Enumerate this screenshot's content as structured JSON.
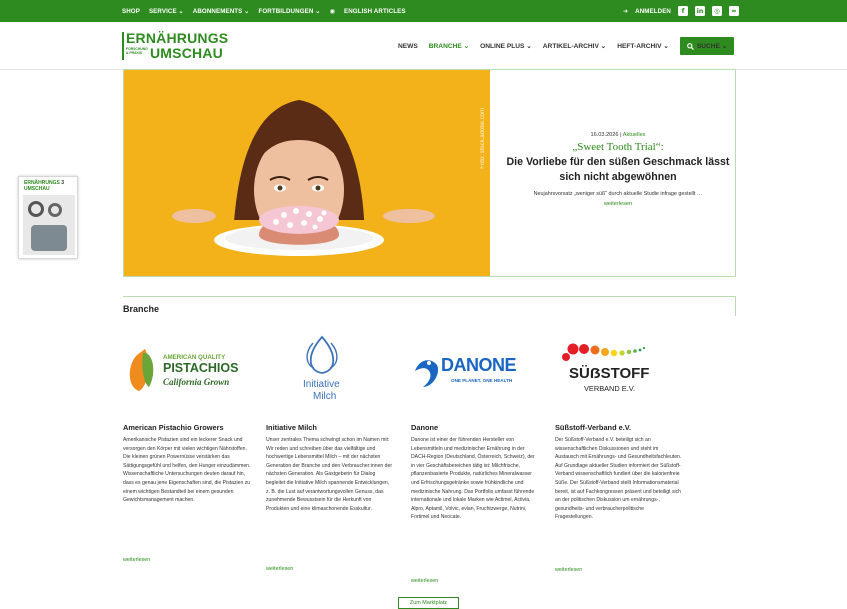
{
  "topbar": {
    "nav": [
      "SHOP",
      "SERVICE ⌄",
      "ABONNEMENTS ⌄",
      "FORTBILDUNGEN ⌄",
      "ENGLISH ARTICLES"
    ],
    "login": "ANMELDEN"
  },
  "header": {
    "logo_line1": "ERNÄHRUNGS",
    "logo_line2": "UMSCHAU",
    "logo_small": "FORSCHUNG & PRAXIS",
    "nav": [
      "NEWS",
      "BRANCHE ⌄",
      "ONLINE PLUS ⌄",
      "ARTIKEL-ARCHIV ⌄",
      "HEFT-ARCHIV ⌄"
    ],
    "search_label": "SUCHE ⌄"
  },
  "magazine": {
    "title_line1": "ERNÄHRUNGS",
    "title_line2": "UMSCHAU",
    "issue": "3"
  },
  "hero": {
    "date": "16.03.2026",
    "category": "Aktuelles",
    "title_quote": "„Sweet Tooth Trial“:",
    "title_main": "Die Vorliebe für den süßen Geschmack lässt sich nicht abgewöhnen",
    "excerpt": "Neujahrsvorsatz „weniger süß“ durch aktuelle Studie infrage gestellt …",
    "more": "weiterlesen",
    "image_credit": "Foto: stock.adobe.com"
  },
  "section": {
    "title": "Branche"
  },
  "cards": [
    {
      "name": "American Pistachio Growers",
      "logo": {
        "line1": "AMERICAN QUALITY",
        "line2": "PISTACHIOS",
        "line3": "California Grown"
      },
      "desc": "Amerikanische Pistazien sind ein leckerer Snack und versorgen den Körper mit vielen wichtigen Nährstoffen. Die kleinen grünen Powernüsse verstärken das Sättigungsgefühl und helfen, den Hunger einzudämmen. Wissenschaftliche Untersuchungen deuten darauf hin, dass es genau jene Eigenschaften sind, die Pistazien zu einem wichtigen Bestandteil bei einem gesunden Gewichtsmanagement machen.",
      "more": "weiterlesen"
    },
    {
      "name": "Initiative Milch",
      "logo": {
        "line1": "Initiative",
        "line2": "Milch"
      },
      "desc": "Unser zentrales Thema schwingt schon im Namen mit: Wir reden und schreiben über das vielfältige und hochwertige Lebensmittel Milch – mit der nächsten Generation der Branche und den Verbraucher:innen der nächsten Generation. Als Gastgeberin für Dialog begleitet die Initiative Milch spannende Entwicklungen, z. B. die Lust auf verantwortungsvollen Genuss, das zunehmende Bewusstsein für die Herkunft von Produkten und eine klimaschonende Esskultur.",
      "more": "weiterlesen"
    },
    {
      "name": "Danone",
      "logo": {
        "line1": "DANONE",
        "line2": "ONE PLANET. ONE HEALTH"
      },
      "desc": "Danone ist einer der führenden Hersteller von Lebensmitteln und medizinischer Ernährung in der DACH-Region (Deutschland, Österreich, Schweiz), der in vier Geschäftsbereichen tätig ist: Milchfrische, pflanzenbasierte Produkte, natürliches Mineralwasser und Erfrischungsgetränke sowie frühkindliche und medizinische Nahrung. Das Portfolio umfasst führende internationale und lokale Marken wie Actimel, Activia, Alpro, Aptamil, Volvic, evian, Fruchtzwerge, Nutrini, Fortimel und Neocate.",
      "more": "weiterlesen"
    },
    {
      "name": "Süßstoff-Verband e.V.",
      "logo": {
        "line1": "SÜẞSTOFF",
        "line2": "VERBAND E.V."
      },
      "desc": "Der Süßstoff-Verband e.V. beteiligt sich an wissenschaftlichen Diskussionen und steht im Austausch mit Ernährungs- und Gesundheitsfachleuten. Auf Grundlage aktueller Studien informiert der Süßstoff-Verband wissenschaftlich fundiert über die kalorienfreie Süße. Der Süßstoff-Verband stellt Informationsmaterial bereit, ist auf Fachkongressen präsent und beteiligt sich an der politischen Diskussion um ernährungs-, gesundheits- und verbraucherpolitische Fragestellungen.",
      "more": "weiterlesen"
    }
  ],
  "marketplace_button": "Zum Marktplatz",
  "colors": {
    "brand_green": "#2e8b1f",
    "hero_bg": "#f3b21a"
  }
}
